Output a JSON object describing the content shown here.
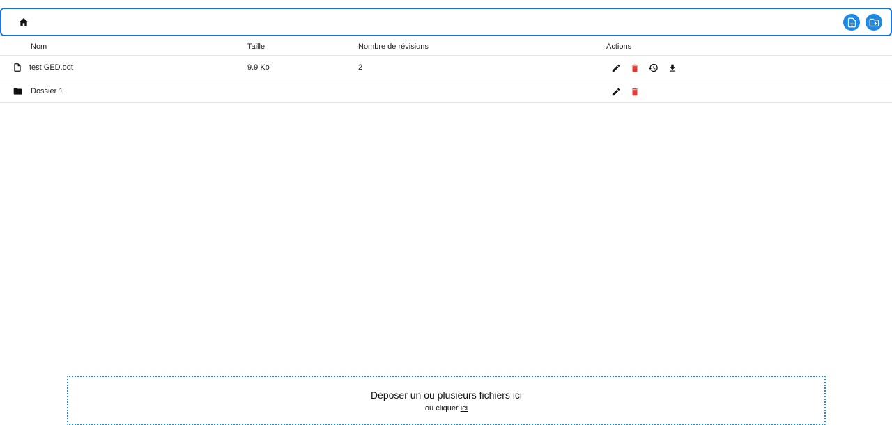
{
  "toolbar": {
    "home_icon": "home-icon",
    "new_file_icon": "note-add-icon",
    "new_folder_icon": "create-new-folder-icon",
    "accent": "#1e88e5"
  },
  "table": {
    "columns": [
      "Nom",
      "Taille",
      "Nombre de révisions",
      "Actions"
    ],
    "rows": [
      {
        "type": "file",
        "icon": "file-icon",
        "name": "test GED.odt",
        "size": "9.9 Ko",
        "revisions": "2",
        "actions": [
          "edit-icon",
          "delete-icon",
          "history-icon",
          "download-icon"
        ]
      },
      {
        "type": "folder",
        "icon": "folder-icon",
        "name": "Dossier 1",
        "size": "",
        "revisions": "",
        "actions": [
          "edit-icon",
          "delete-icon"
        ]
      }
    ]
  },
  "dropzone": {
    "title": "Déposer un ou plusieurs fichiers ici",
    "sub_prefix": "ou cliquer",
    "link": "ici"
  },
  "colors": {
    "delete": "#e53935",
    "border": "#1976d2"
  }
}
